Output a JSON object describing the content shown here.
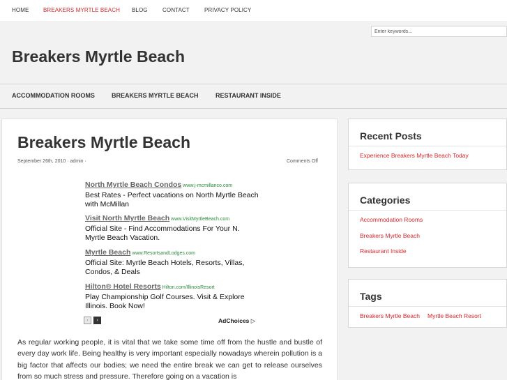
{
  "top_nav": {
    "home": "HOME",
    "breakers": "BREAKERS MYRTLE BEACH",
    "blog": "BLOG",
    "contact": "CONTACT",
    "privacy": "PRIVACY POLICY"
  },
  "search": {
    "placeholder": "Enter keywords..."
  },
  "site_title": "Breakers Myrtle Beach",
  "cat_nav": {
    "accommodation": "ACCOMMODATION ROOMS",
    "breakers": "BREAKERS MYRTLE BEACH",
    "restaurant": "RESTAURANT INSIDE"
  },
  "post": {
    "title": "Breakers Myrtle Beach",
    "meta_left": "September 26th, 2010 · admin ·",
    "meta_right": "Comments Off",
    "body": "As regular working people, it is vital that we take some time off from the hustle and bustle of every day work life. Being healthy is very important especially nowadays wherein pollution is a big factor that affects our bodies; we need the entire break we can get to release ourselves from so much stress and pressure. Therefore going on a vacation is"
  },
  "ads": {
    "items": [
      {
        "title": "North Myrtle Beach Condos",
        "url": "www.j-mcmillanco.com",
        "desc": "Best Rates - Perfect vacations on North Myrtle Beach with McMillan"
      },
      {
        "title": "Visit North Myrtle Beach",
        "url": "www.VisitMyrtleBeach.com",
        "desc": "Official Site - Find Accommodations For Your N. Myrtle Beach Vacation."
      },
      {
        "title": "Myrtle Beach",
        "url": "www.ResortsandLodges.com",
        "desc": "Official Site: Myrtle Beach Hotels, Resorts, Villas, Condos, & Deals"
      },
      {
        "title": "Hilton® Hotel Resorts",
        "url": "Hilton.com/IllinoisResort",
        "desc": "Play Championship Golf Courses. Visit & Explore Illinois. Book Now!"
      }
    ],
    "prev_icon": "‹",
    "next_icon": "›",
    "adchoices": "AdChoices ▷"
  },
  "sidebar": {
    "recent": {
      "title": "Recent Posts",
      "items": [
        "Experience Breakers Myrtle Beach Today"
      ]
    },
    "categories": {
      "title": "Categories",
      "items": [
        "Accommodation Rooms",
        "Breakers Myrtle Beach",
        "Restaurant Inside"
      ]
    },
    "tags": {
      "title": "Tags",
      "items": [
        "Breakers Myrtle Beach",
        "Myrtle Beach Resort"
      ]
    }
  },
  "colors": {
    "accent": "#d8262a",
    "background": "#f2f2f2",
    "ad_url": "#2a8a3a"
  }
}
